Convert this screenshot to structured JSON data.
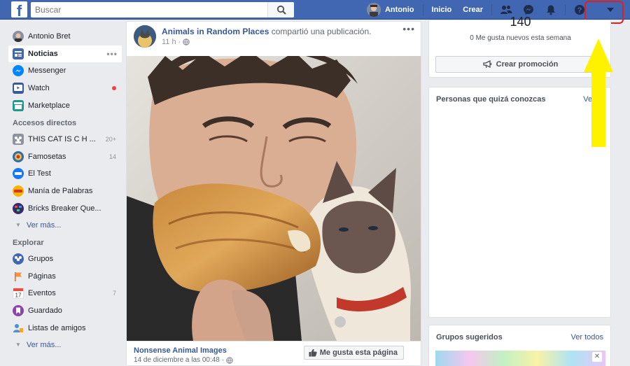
{
  "topbar": {
    "logo": "f",
    "search_placeholder": "Buscar",
    "user_name": "Antonio",
    "home": "Inicio",
    "create": "Crear"
  },
  "sidebar": {
    "profile": "Antonio Bret",
    "main": [
      {
        "label": "Noticias"
      },
      {
        "label": "Messenger"
      },
      {
        "label": "Watch"
      },
      {
        "label": "Marketplace"
      }
    ],
    "shortcuts_title": "Accesos directos",
    "shortcuts": [
      {
        "label": "THIS CAT IS C H ...",
        "count": "20+"
      },
      {
        "label": "Famosetas",
        "count": "14"
      },
      {
        "label": "El Test",
        "count": ""
      },
      {
        "label": "Manía de Palabras",
        "count": ""
      },
      {
        "label": "Bricks Breaker Que...",
        "count": ""
      }
    ],
    "more_label": "Ver más...",
    "explore_title": "Explorar",
    "explore": [
      {
        "label": "Grupos",
        "count": ""
      },
      {
        "label": "Páginas",
        "count": ""
      },
      {
        "label": "Eventos",
        "count": "7"
      },
      {
        "label": "Guardado",
        "count": ""
      },
      {
        "label": "Listas de amigos",
        "count": ""
      }
    ],
    "more_label2": "Ver más..."
  },
  "post": {
    "page_name": "Animals in Random Places",
    "verb": "compartió una publicación.",
    "time": "11 h",
    "source_name": "Nonsense Animal Images",
    "source_date": "14 de diciembre a las 00:48",
    "like_page_btn": "Me gusta esta página"
  },
  "right": {
    "likes_count": "140",
    "likes_week": "0 Me gusta nuevos esta semana",
    "promo_btn": "Crear promoción",
    "pymk_title": "Personas que quizá conozcas",
    "pymk_link": "Ver to",
    "groups_title": "Grupos sugeridos",
    "groups_link": "Ver todos"
  },
  "colors": {
    "brand": "#4267b2",
    "annotation_box": "#e02020",
    "annotation_arrow": "#fff200"
  }
}
